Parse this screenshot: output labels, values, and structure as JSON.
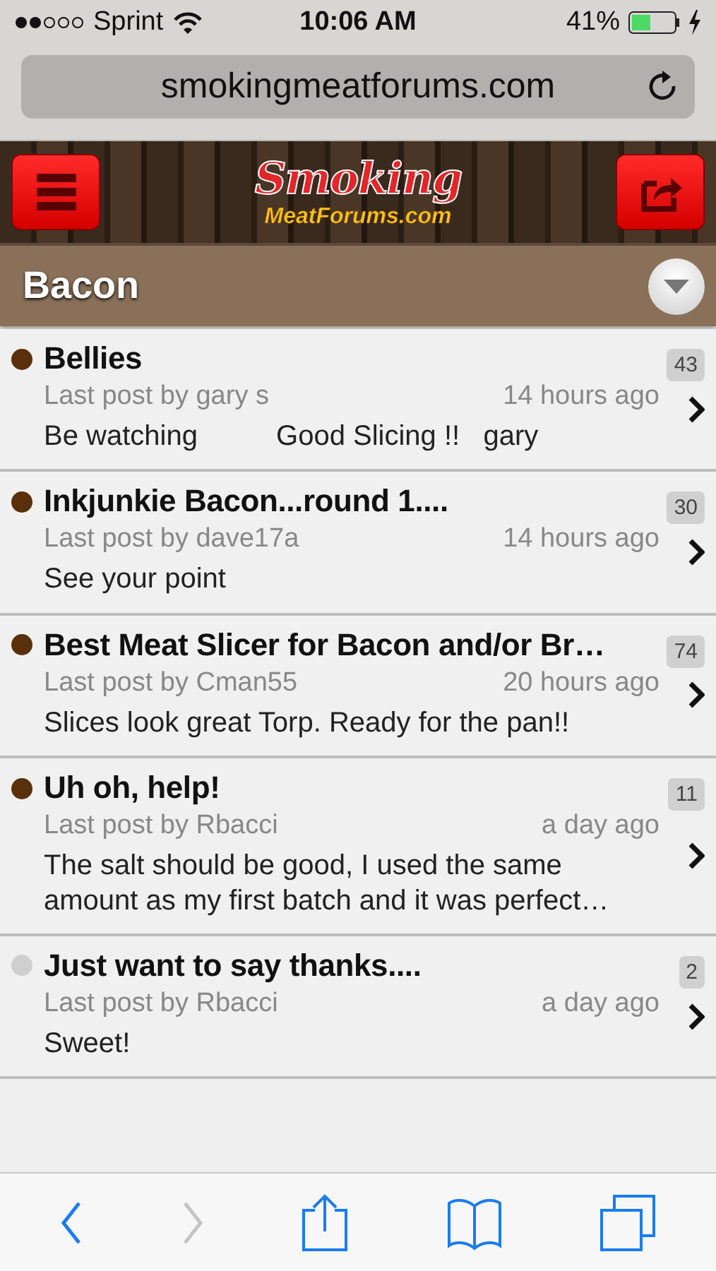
{
  "status_bar": {
    "carrier": "Sprint",
    "time": "10:06 AM",
    "battery": "41%"
  },
  "address_bar": {
    "url": "smokingmeatforums.com"
  },
  "header": {
    "logo_top": "Smoking",
    "logo_bottom": "MeatForums.com"
  },
  "forum": {
    "title": "Bacon"
  },
  "threads": [
    {
      "title": "Bellies",
      "unread": true,
      "count": "43",
      "last_post": "Last post by gary s",
      "time": "14 hours ago",
      "excerpt": "Be watching          Good Slicing !!   gary"
    },
    {
      "title": "Inkjunkie Bacon...round 1....",
      "unread": true,
      "count": "30",
      "last_post": "Last post by dave17a",
      "time": "14 hours ago",
      "excerpt": "See your point"
    },
    {
      "title": "Best Meat Slicer for Bacon and/or Br…",
      "unread": true,
      "count": "74",
      "last_post": "Last post by Cman55",
      "time": "20 hours ago",
      "excerpt": "Slices look great Torp. Ready for the pan!!"
    },
    {
      "title": "Uh oh, help!",
      "unread": true,
      "count": "11",
      "last_post": "Last post by Rbacci",
      "time": "a day ago",
      "excerpt": "The salt should be good, I used the same amount as my first batch and it was perfect…"
    },
    {
      "title": "Just want to say thanks....",
      "unread": false,
      "count": "2",
      "last_post": "Last post by Rbacci",
      "time": "a day ago",
      "excerpt": "Sweet!"
    }
  ],
  "toolbar": [
    {
      "kind": "back",
      "disabled": false
    },
    {
      "kind": "forward",
      "disabled": true
    },
    {
      "kind": "share",
      "disabled": false
    },
    {
      "kind": "bookmarks",
      "disabled": false
    },
    {
      "kind": "tabs",
      "disabled": false
    }
  ]
}
